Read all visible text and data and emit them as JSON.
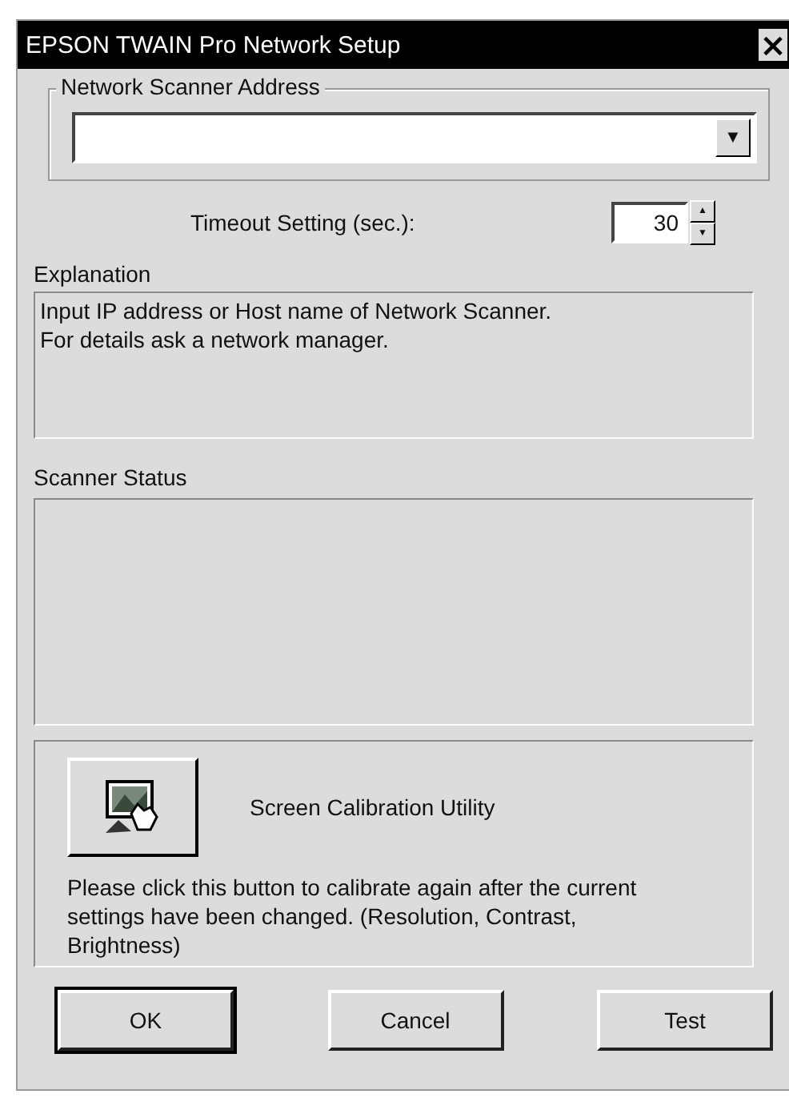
{
  "window": {
    "title": "EPSON TWAIN Pro Network Setup",
    "close": "×"
  },
  "address_group": {
    "label": "Network Scanner Address",
    "combo_arrow": "▼"
  },
  "timeout": {
    "label": "Timeout Setting (sec.):",
    "value": "30",
    "up": "▲",
    "down": "▼"
  },
  "explanation": {
    "label": "Explanation",
    "text": "Input IP address or Host name of Network Scanner.\nFor details ask a network manager."
  },
  "scanner_status": {
    "label": "Scanner Status"
  },
  "calibration": {
    "button_label": "Screen Calibration Utility",
    "text": "Please click this button to calibrate again after the current settings have been changed. (Resolution, Contrast, Brightness)"
  },
  "buttons": [
    {
      "label": "OK",
      "default": true
    },
    {
      "label": "Cancel",
      "default": false
    },
    {
      "label": "Test",
      "default": false
    }
  ]
}
